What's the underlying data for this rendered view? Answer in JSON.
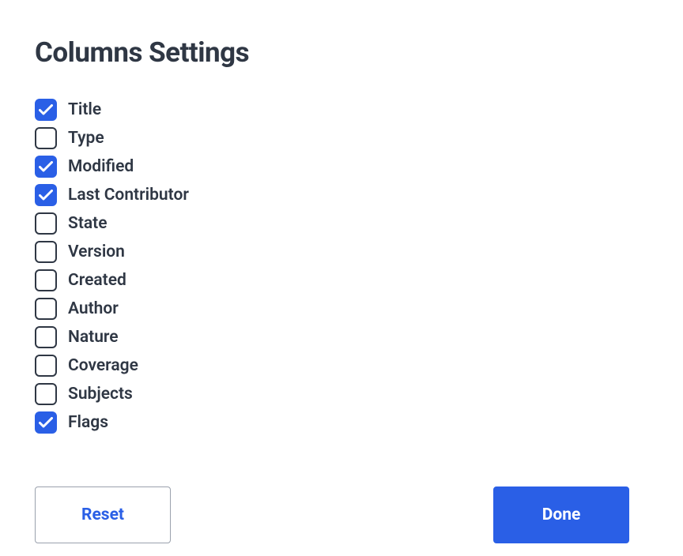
{
  "header": {
    "title": "Columns Settings"
  },
  "options": [
    {
      "label": "Title",
      "checked": true
    },
    {
      "label": "Type",
      "checked": false
    },
    {
      "label": "Modified",
      "checked": true
    },
    {
      "label": "Last Contributor",
      "checked": true
    },
    {
      "label": "State",
      "checked": false
    },
    {
      "label": "Version",
      "checked": false
    },
    {
      "label": "Created",
      "checked": false
    },
    {
      "label": "Author",
      "checked": false
    },
    {
      "label": "Nature",
      "checked": false
    },
    {
      "label": "Coverage",
      "checked": false
    },
    {
      "label": "Subjects",
      "checked": false
    },
    {
      "label": "Flags",
      "checked": true
    }
  ],
  "footer": {
    "reset_label": "Reset",
    "done_label": "Done"
  }
}
